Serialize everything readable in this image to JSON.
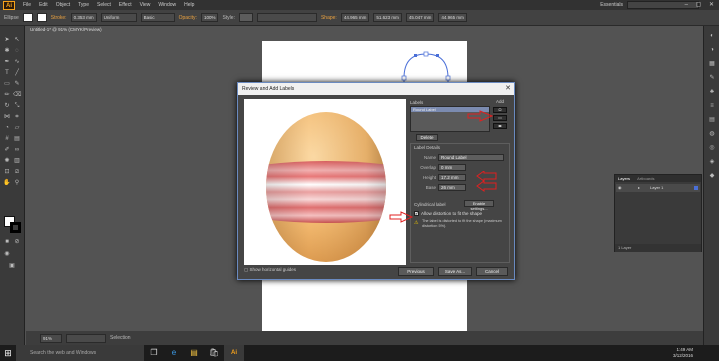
{
  "app": {
    "logo": "Ai",
    "workspace": "Essentials",
    "window_controls": "– ▢ ✕"
  },
  "menu": [
    "File",
    "Edit",
    "Object",
    "Type",
    "Select",
    "Effect",
    "View",
    "Window",
    "Help"
  ],
  "control_bar": {
    "selection": "Ellipse",
    "stroke_label": "Stroke:",
    "stroke_value": "0.353 mm",
    "profile": "Uniform",
    "brush": "Basic",
    "opacity_label": "Opacity:",
    "opacity_value": "100%",
    "style_label": "Style:",
    "shape_label": "Shape:",
    "w_value": "44.965 mm",
    "x_value": "51.623 mm",
    "h_value": "45.047 mm",
    "y_value": "44.965 mm"
  },
  "document": {
    "tab_title": "Untitled-1* @ 91% (CMYK/Preview)",
    "zoom": "91%",
    "status_tool": "Selection"
  },
  "dialog": {
    "title": "Review and Add Labels",
    "close": "✕",
    "labels_heading": "Labels",
    "add_heading": "Add",
    "label_items": [
      "Round Label"
    ],
    "add_buttons": [
      "⬭",
      "▭",
      "⬬"
    ],
    "delete_button": "Delete",
    "details_heading": "Label Details",
    "fields": [
      {
        "label": "Name",
        "value": "Round Label"
      },
      {
        "label": "Overlap",
        "value": "0 mm"
      },
      {
        "label": "Height",
        "value": "17.2 mm"
      },
      {
        "label": "Base",
        "value": "26 mm"
      }
    ],
    "cylindrical_label": "Cylindrical label",
    "advanced_button": "Enable settings...",
    "allow_distortion": "Allow distortion to fit the shape",
    "allow_distortion_checked": true,
    "warning_text": "The label is distorted to fit the shape (maximum distortion 5%).",
    "show_guides": "Show horizontal guides",
    "buttons": {
      "previous": "Previous",
      "save_as": "Save As...",
      "cancel": "Cancel"
    }
  },
  "layers_panel": {
    "tabs": [
      "Layers",
      "Artboards"
    ],
    "layer_name": "Layer 1",
    "footer": "1 Layer"
  },
  "taskbar": {
    "search_placeholder": "Search the web and Windows",
    "time": "1:49 AM",
    "date": "3/12/2016"
  },
  "colors": {
    "annotation_red": "#e02020",
    "dialog_border": "#6a8ac0",
    "egg_top": "#f5c07e",
    "label_stripe": "#e06c6c"
  },
  "icons": {
    "windows_logo": "⊞",
    "task_view": "❐",
    "edge": "e",
    "explorer": "▤",
    "store": "🛍",
    "illustrator": "Ai"
  }
}
